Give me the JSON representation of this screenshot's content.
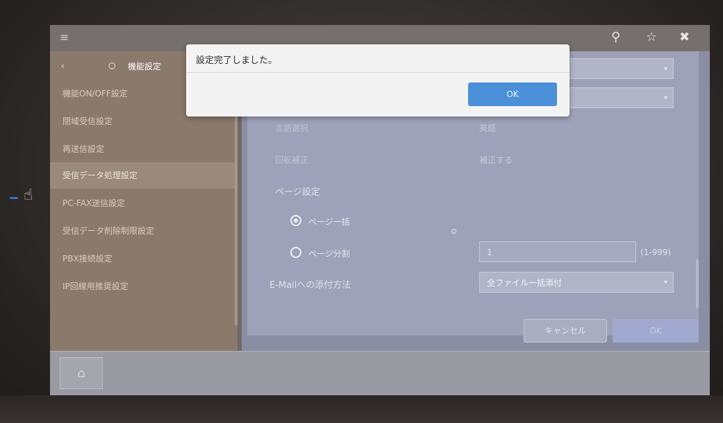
{
  "sidebar": {
    "breadcrumb": {
      "back_icon": "chevron-left-icon",
      "dot": "○",
      "title": "機能設定"
    },
    "items": [
      {
        "label": "機能ON/OFF設定",
        "active": false
      },
      {
        "label": "閉域受信設定",
        "active": false
      },
      {
        "label": "再送信設定",
        "active": false
      },
      {
        "label": "受信データ処理設定",
        "active": true
      },
      {
        "label": "PC-FAX送信設定",
        "active": false
      },
      {
        "label": "受信データ削除制限設定",
        "active": false
      },
      {
        "label": "PBX接続設定",
        "active": false
      },
      {
        "label": "IP回線用推奨設定",
        "active": false
      }
    ]
  },
  "topbar": {
    "menu_icon": "≡",
    "search_icon": "⚲",
    "star_icon": "☆",
    "close_icon": "✖"
  },
  "form": {
    "language_label": "言語選択",
    "language_value": "英語",
    "rotation_label": "回転補正",
    "rotation_value": "補正する",
    "page_setting_label": "ページ設定",
    "page_all_label": "ページ一括",
    "page_split_label": "ページ分割",
    "page_split_value": "1",
    "page_split_range": "(1-999)",
    "attach_label": "E-Mailへの添付方法",
    "attach_value": "全ファイル一括添付"
  },
  "actions": {
    "cancel_label": "キャンセル",
    "ok_label": "OK"
  },
  "dialog": {
    "message": "設定完了しました。",
    "ok_label": "OK"
  },
  "bottombar": {
    "home_icon": "⌂"
  },
  "device": {
    "touch_icon": "☝"
  },
  "colors": {
    "dialog_ok": "#4a8fd8",
    "led": "#3d6fd6"
  }
}
